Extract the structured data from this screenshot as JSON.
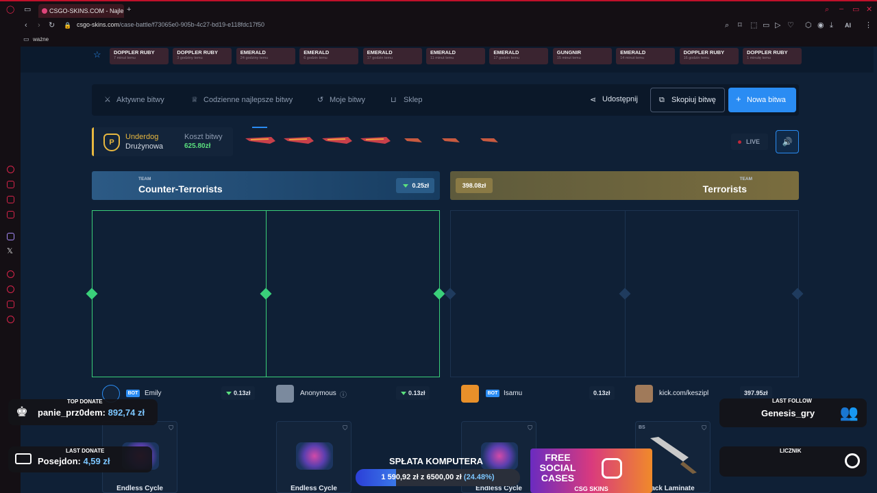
{
  "browser": {
    "tab_title": "CSGO-SKINS.COM - Najle",
    "url_host": "csgo-skins.com",
    "url_path": "/case-battle/f73065e0-905b-4c27-bd19-e118fdc17f50",
    "bookmark": "ważne",
    "toolbar_ai": "AI"
  },
  "drops": [
    {
      "name": "DOPPLER RUBY",
      "time": "7 minut temu"
    },
    {
      "name": "DOPPLER RUBY",
      "time": "3 godziny temu"
    },
    {
      "name": "EMERALD",
      "time": "24 godziny temu"
    },
    {
      "name": "EMERALD",
      "time": "6 godzin temu"
    },
    {
      "name": "EMERALD",
      "time": "17 godzin temu"
    },
    {
      "name": "EMERALD",
      "time": "11 minut temu"
    },
    {
      "name": "EMERALD",
      "time": "17 godzin temu"
    },
    {
      "name": "GUNGNIR",
      "time": "15 minut temu"
    },
    {
      "name": "EMERALD",
      "time": "14 minut temu"
    },
    {
      "name": "DOPPLER RUBY",
      "time": "16 godzin temu"
    },
    {
      "name": "DOPPLER RUBY",
      "time": "1 minutę temu"
    }
  ],
  "nav": {
    "active": "Aktywne bitwy",
    "daily": "Codzienne najlepsze bitwy",
    "mine": "Moje bitwy",
    "shop": "Sklep",
    "share": "Udostępnij",
    "copy": "Skopiuj bitwę",
    "new": "Nowa bitwa"
  },
  "battle": {
    "mode1": "Underdog",
    "mode2": "Drużynowa",
    "cost_label": "Koszt bitwy",
    "cost_value": "625.80zł",
    "live": "LIVE"
  },
  "teams": {
    "ct": {
      "label": "TEAM",
      "name": "Counter-Terrorists",
      "value": "0.25zł"
    },
    "t": {
      "label": "TEAM",
      "name": "Terrorists",
      "value": "398.08zł"
    }
  },
  "players": [
    {
      "name": "Emily",
      "bot": "BOT",
      "value": "0.13zł"
    },
    {
      "name": "Anonymous",
      "value": "0.13zł"
    },
    {
      "name": "Isamu",
      "bot": "BOT",
      "value": "0.13zł"
    },
    {
      "name": "kick.com/keszipl",
      "value": "397.95zł"
    }
  ],
  "cards": [
    {
      "name": "Endless Cycle"
    },
    {
      "name": "Endless Cycle"
    },
    {
      "name": "Endless Cycle"
    },
    {
      "name": "ack Laminate",
      "tag": "BS"
    }
  ],
  "stream": {
    "top_donate_label": "TOP DONATE",
    "top_donate_user": "panie_prz0dem:",
    "top_donate_amount": "892,74 zł",
    "last_donate_label": "LAST DONATE",
    "last_donate_user": "Posejdon:",
    "last_donate_amount": "4,59 zł",
    "last_follow_label": "LAST FOLLOW",
    "last_follow_user": "Genesis_gry",
    "counter_label": "LICZNIK",
    "goal_title": "SPŁATA KOMPUTERA",
    "goal_current": "1 590,92 zł",
    "goal_sep": "z",
    "goal_target": "6500,00 zł",
    "goal_percent": "(24.48%)",
    "goal_fraction": 0.2448,
    "promo_line1": "FREE SOCIAL CASES",
    "promo_brand": "CSG SKINS"
  }
}
